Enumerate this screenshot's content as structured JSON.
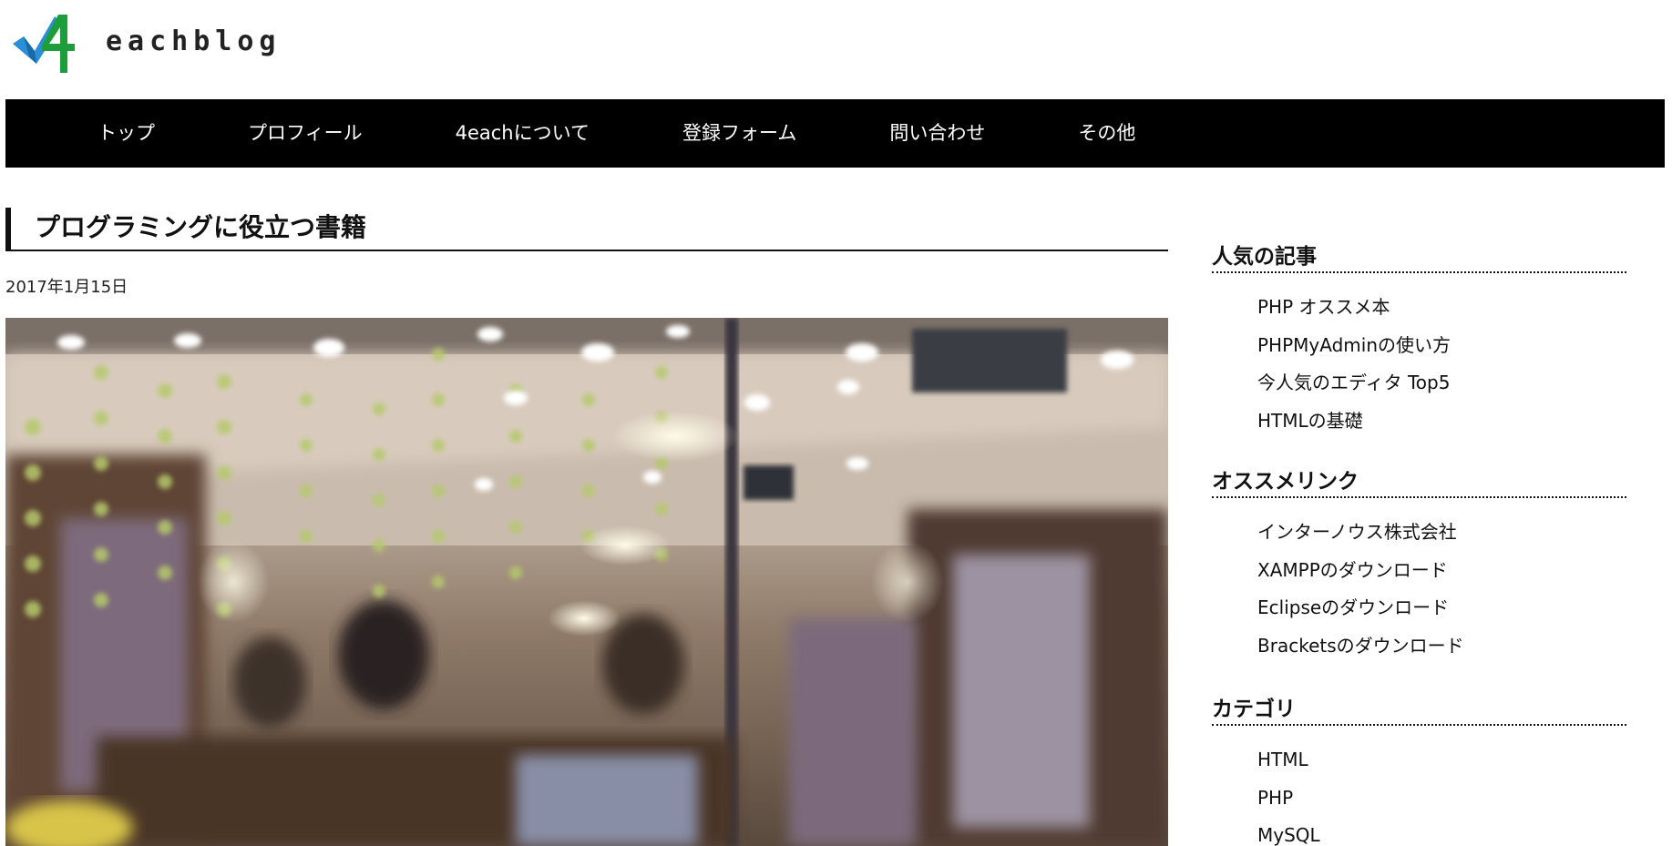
{
  "logo": {
    "text": "eachblog",
    "mark_text": "4",
    "colors": {
      "blue": "#2a8fd6",
      "green": "#1e9e3a",
      "dark": "#222222"
    }
  },
  "nav": {
    "items": [
      {
        "label": "トップ"
      },
      {
        "label": "プロフィール"
      },
      {
        "label": "4eachについて"
      },
      {
        "label": "登録フォーム"
      },
      {
        "label": "問い合わせ"
      },
      {
        "label": "その他"
      }
    ]
  },
  "article": {
    "title": "プログラミングに役立つ書籍",
    "date": "2017年1月15日"
  },
  "sidebar": {
    "popular": {
      "title": "人気の記事",
      "items": [
        "PHP オススメ本",
        "PHPMyAdminの使い方",
        "今人気のエディタ Top5",
        "HTMLの基礎"
      ]
    },
    "links": {
      "title": "オススメリンク",
      "items": [
        "インターノウス株式会社",
        "XAMPPのダウンロード",
        "Eclipseのダウンロード",
        "Bracketsのダウンロード"
      ]
    },
    "categories": {
      "title": "カテゴリ",
      "items": [
        "HTML",
        "PHP",
        "MySQL"
      ]
    }
  }
}
